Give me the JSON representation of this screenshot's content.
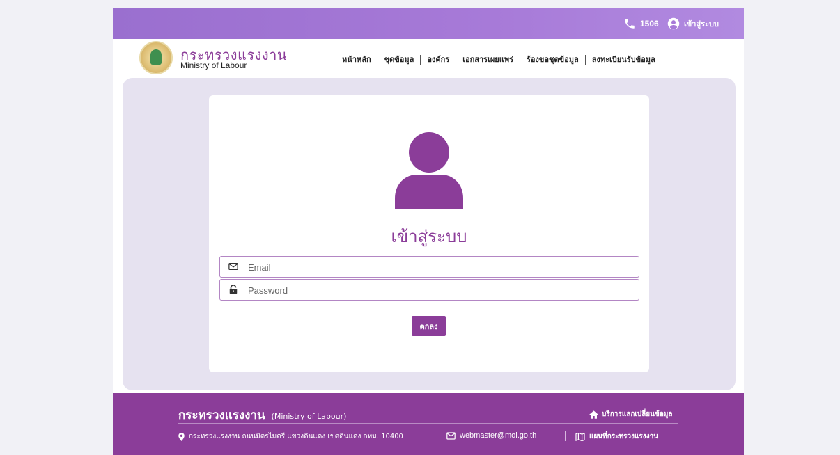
{
  "topbar": {
    "phone_number": "1506",
    "login_link": "เข้าสู่ระบบ"
  },
  "header": {
    "org_name_th": "กระทรวงแรงงาน",
    "org_name_en": "Ministry of Labour",
    "nav": [
      {
        "label": "หน้าหลัก"
      },
      {
        "label": "ชุดข้อมูล"
      },
      {
        "label": "องค์กร"
      },
      {
        "label": "เอกสารเผยแพร่"
      },
      {
        "label": "ร้องขอชุดข้อมูล"
      },
      {
        "label": "ลงทะเบียนรับข้อมูล"
      }
    ]
  },
  "login": {
    "title": "เข้าสู่ระบบ",
    "email_placeholder": "Email",
    "password_placeholder": "Password",
    "submit_label": "ตกลง"
  },
  "footer": {
    "title_th": "กระทรวงแรงงาน",
    "title_en": "(Ministry of Labour)",
    "exchange_link": "บริการแลกเปลี่ยนข้อมูล",
    "address": "กระทรวงแรงงาน ถนนมิตรไมตรี แขวงดินแดง เขตดินแดง กทม. 10400",
    "email": "webmaster@mol.go.th",
    "map_link": "แผนที่กระทรวงแรงงาน"
  },
  "icons": {
    "phone": "phone-icon",
    "user_circle": "user-circle-icon",
    "avatar": "user-avatar-icon",
    "envelope": "envelope-icon",
    "lock": "lock-icon",
    "home": "home-icon",
    "location": "map-marker-icon",
    "map": "map-icon"
  },
  "colors": {
    "brand_purple": "#8b3d99",
    "topbar_purple": "#a77ad8",
    "panel_bg": "#e6e2f0"
  }
}
